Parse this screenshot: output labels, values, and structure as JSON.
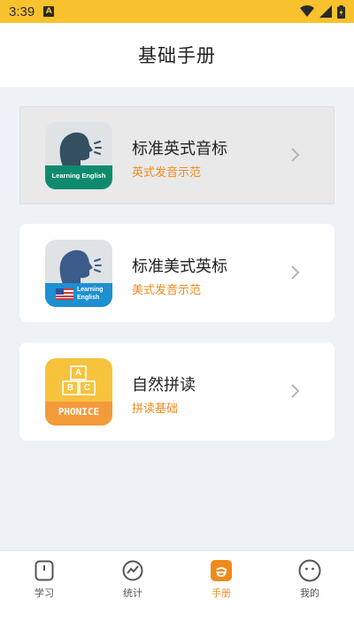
{
  "status_bar": {
    "time": "3:39",
    "notification_icon": "A"
  },
  "header": {
    "title": "基础手册"
  },
  "cards": [
    {
      "title": "标准英式音标",
      "subtitle": "英式发音示范",
      "icon_caption": "Learning English",
      "icon": "speaking-head-uk-icon"
    },
    {
      "title": "标准美式英标",
      "subtitle": "美式发音示范",
      "icon_caption_line1": "Learning",
      "icon_caption_line2": "English",
      "icon": "speaking-head-us-icon"
    },
    {
      "title": "自然拼读",
      "subtitle": "拼读基础",
      "icon_caption": "PHONICE",
      "icon_blocks": [
        "A",
        "B",
        "C"
      ],
      "icon": "abc-blocks-icon"
    }
  ],
  "bottom_nav": [
    {
      "label": "学习",
      "icon": "study-icon",
      "active": false
    },
    {
      "label": "统计",
      "icon": "stats-icon",
      "active": false
    },
    {
      "label": "手册",
      "icon": "handbook-icon",
      "active": true
    },
    {
      "label": "我的",
      "icon": "profile-icon",
      "active": false
    }
  ],
  "colors": {
    "accent": "#f08a1c",
    "status_bar": "#f7c22d",
    "subtitle": "#ef8b1f",
    "teal": "#0f8a6f",
    "blue": "#1e8fd0"
  }
}
